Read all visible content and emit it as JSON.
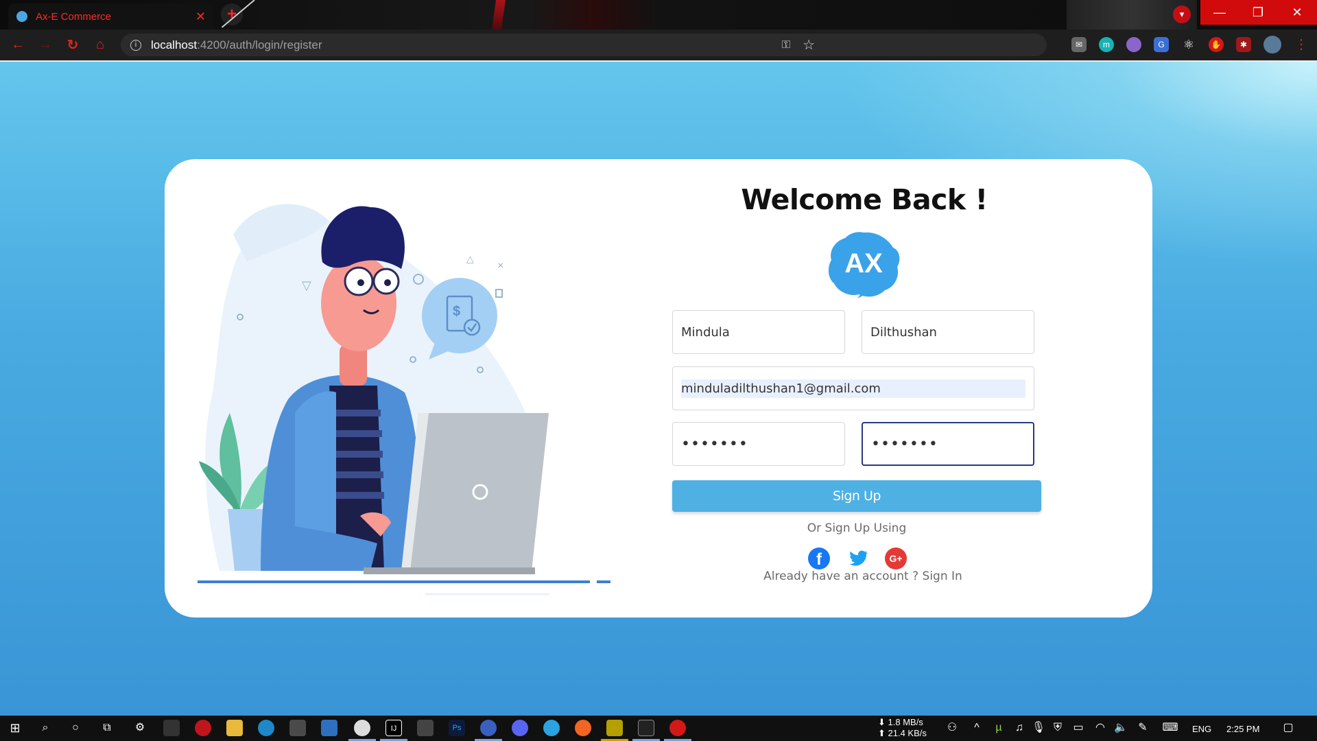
{
  "browser": {
    "tab_title": "Ax-E Commerce",
    "tab_close": "✕",
    "new_tab": "+",
    "url_host": "localhost",
    "url_path": ":4200/auth/login/register",
    "window": {
      "minimize": "—",
      "maximize": "❐",
      "close": "✕"
    }
  },
  "form": {
    "heading": "Welcome Back !",
    "logo_text": "AX",
    "first_name": "Mindula",
    "last_name": "Dilthushan",
    "email": "minduladilthushan1@gmail.com",
    "password": "•••••••",
    "confirm_password": "•••••••",
    "signup_label": "Sign Up",
    "or_text": "Or Sign Up Using",
    "already_text": "Already have an account ? Sign In"
  },
  "social": [
    {
      "name": "facebook",
      "icon": "facebook-icon",
      "glyph": "f",
      "color": "#1877f2"
    },
    {
      "name": "twitter",
      "icon": "twitter-icon",
      "color": "#1da1f2"
    },
    {
      "name": "google-plus",
      "icon": "google-plus-icon",
      "glyph": "G+",
      "color": "#e53935"
    }
  ],
  "taskbar": {
    "net_down": "1.8 MB/s",
    "net_up": "21.4 KB/s",
    "language": "ENG",
    "time": "2:25 PM"
  },
  "colors": {
    "accent": "#4fb0e3",
    "focus_border": "#263a80",
    "page_bg": "#49abe1",
    "chrome_red": "#e0221f"
  }
}
